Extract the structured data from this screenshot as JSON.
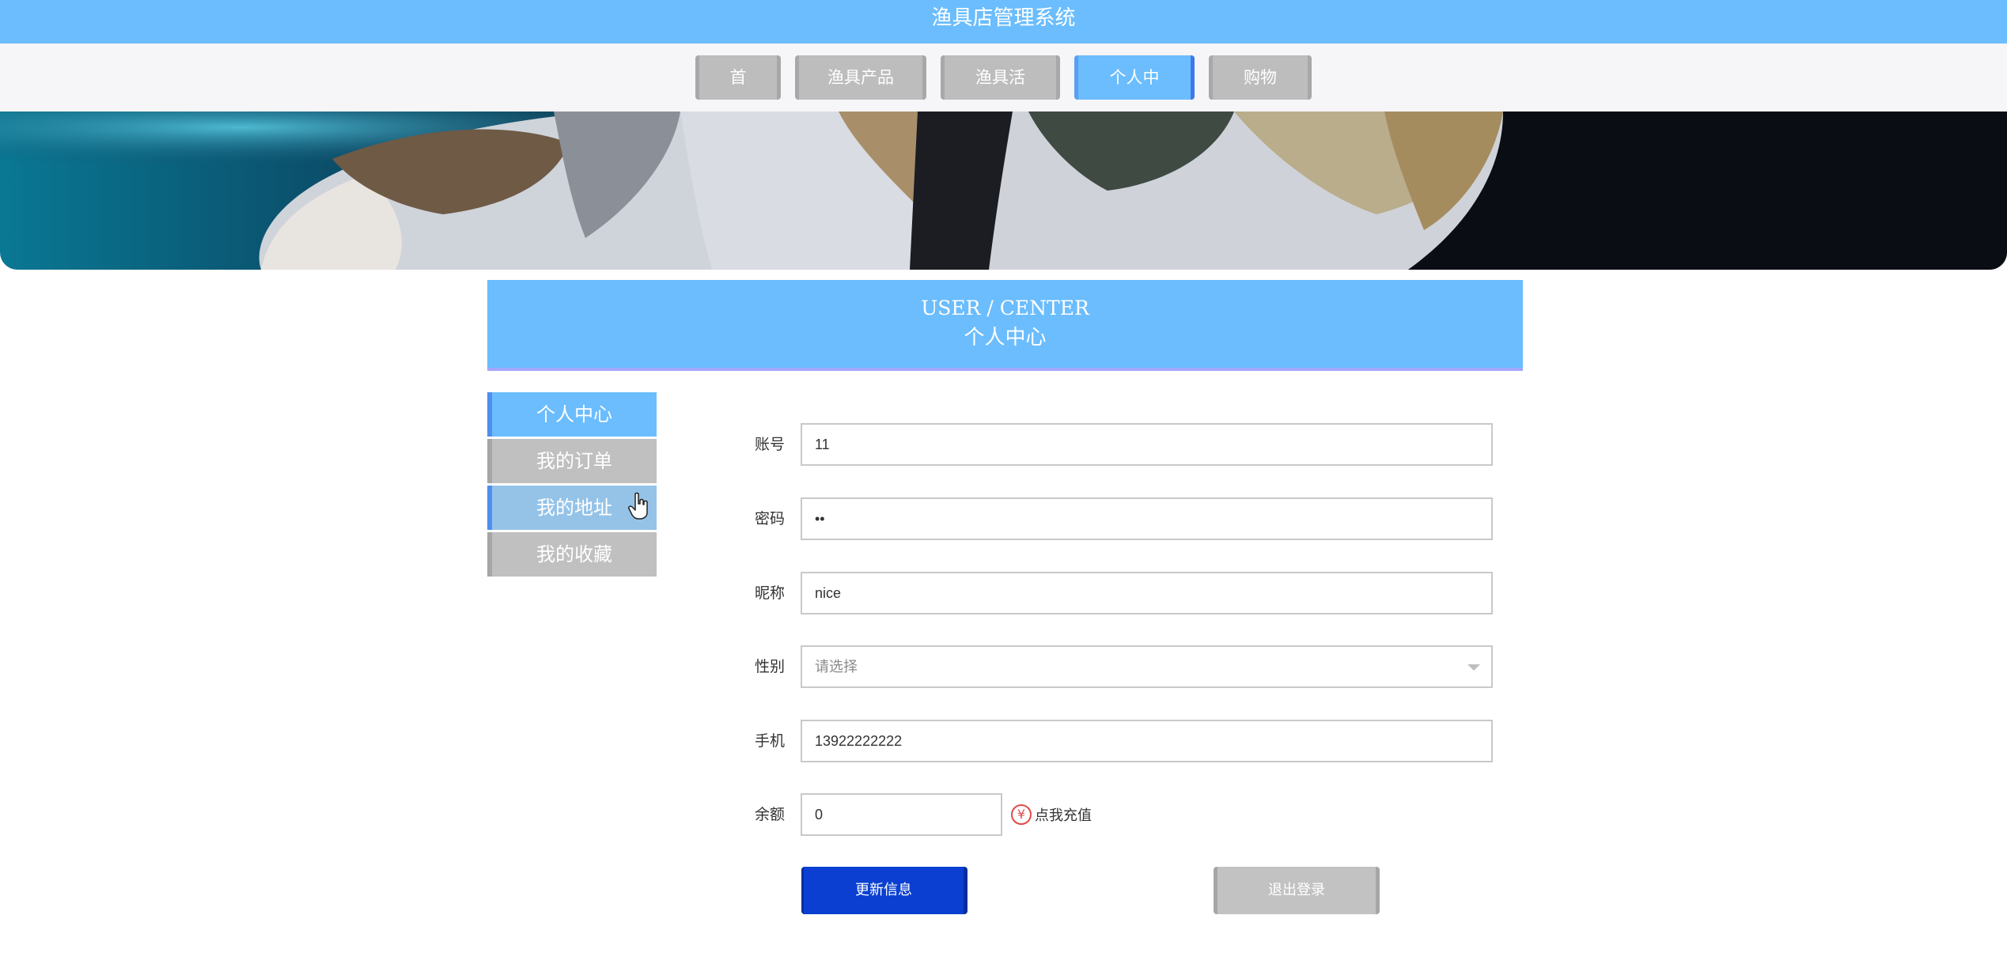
{
  "app": {
    "title": "渔具店管理系统"
  },
  "nav": {
    "items": [
      {
        "label": "首页",
        "active": false
      },
      {
        "label": "渔具产品",
        "active": false
      },
      {
        "label": "渔具活动",
        "active": false
      },
      {
        "label": "个人中心",
        "active": true
      },
      {
        "label": "购物车",
        "active": false
      }
    ]
  },
  "section": {
    "title_en": "USER / CENTER",
    "title_cn": "个人中心"
  },
  "side_menu": {
    "items": [
      {
        "label": "个人中心",
        "state": "active"
      },
      {
        "label": "我的订单",
        "state": "normal"
      },
      {
        "label": "我的地址",
        "state": "hover"
      },
      {
        "label": "我的收藏",
        "state": "normal"
      }
    ]
  },
  "form": {
    "account": {
      "label": "账号",
      "value": "11"
    },
    "password": {
      "label": "密码",
      "value": "••"
    },
    "nickname": {
      "label": "昵称",
      "value": "nice"
    },
    "gender": {
      "label": "性别",
      "placeholder": "请选择"
    },
    "phone": {
      "label": "手机",
      "value": "13922222222"
    },
    "balance": {
      "label": "余额",
      "value": "0",
      "recharge_label": "点我充值",
      "currency_symbol": "¥"
    }
  },
  "actions": {
    "update_label": "更新信息",
    "logout_label": "退出登录"
  },
  "colors": {
    "primary": "#6bbdfd",
    "button": "#0a3fd1",
    "accent_line": "#a4a6ff"
  }
}
